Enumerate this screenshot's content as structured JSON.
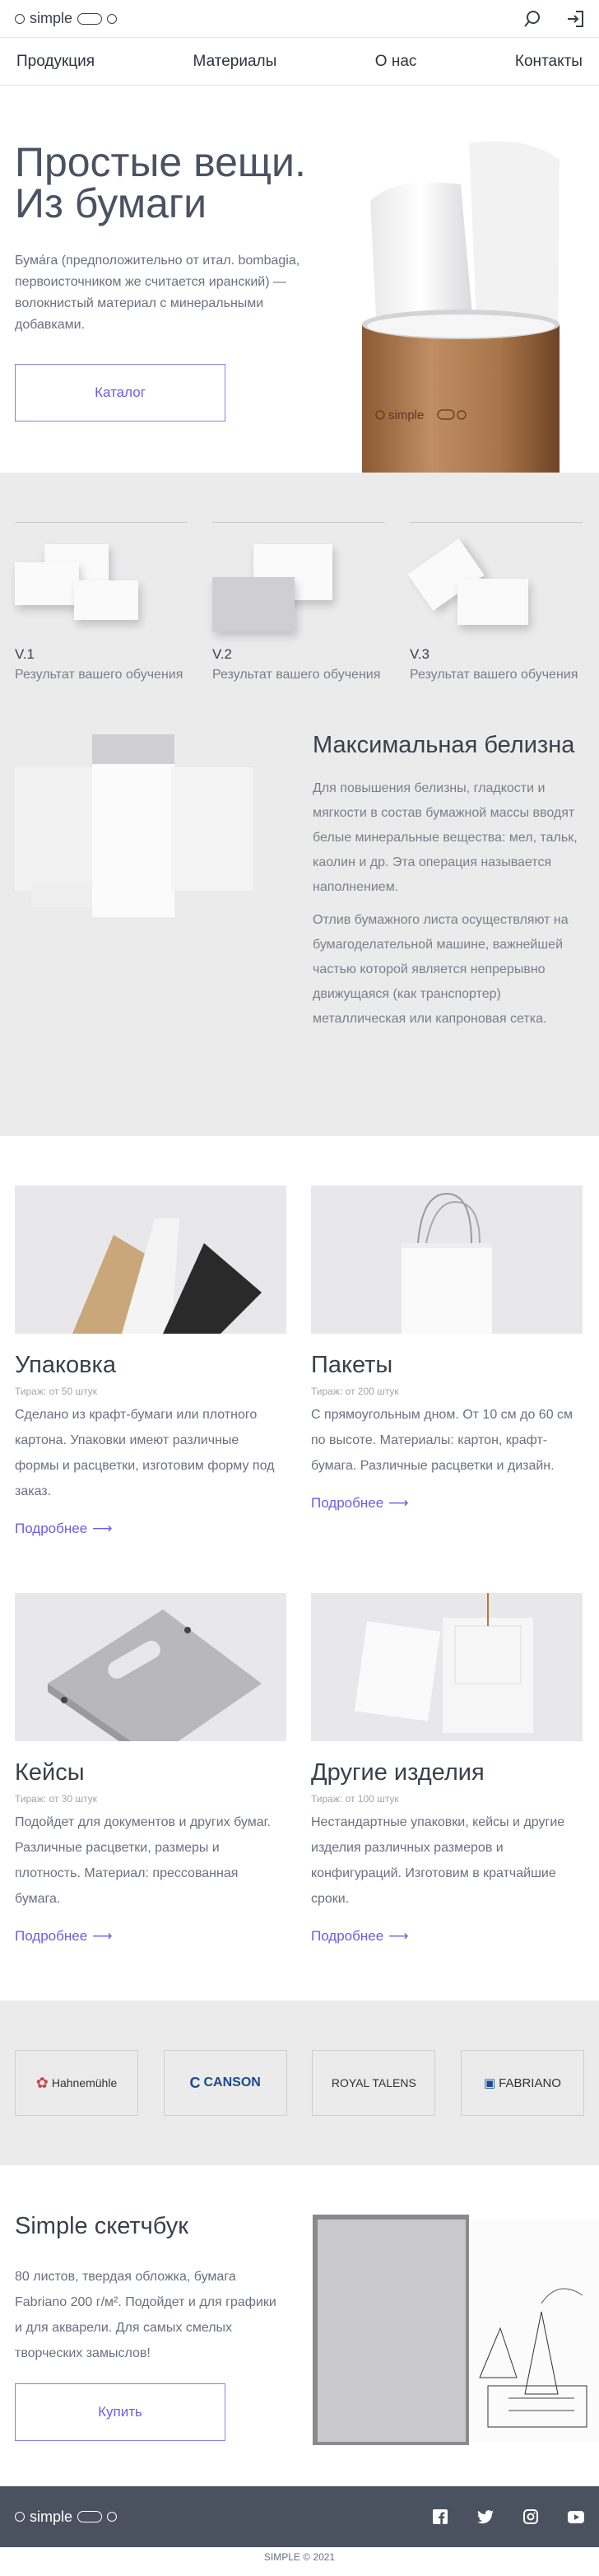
{
  "header": {
    "logo": "simple"
  },
  "nav": [
    "Продукция",
    "Материалы",
    "О нас",
    "Контакты"
  ],
  "hero": {
    "title_line1": "Простые вещи.",
    "title_line2": "Из бумаги",
    "text": "Бума́га (предположительно от итал. bombagia, первоисточником же считается иранский) — волокнистый материал с минеральными добавками.",
    "button": "Каталог",
    "tube_logo": "simple"
  },
  "products": [
    {
      "version": "V.1",
      "desc": "Результат вашего обучения"
    },
    {
      "version": "V.2",
      "desc": "Результат вашего обучения"
    },
    {
      "version": "V.3",
      "desc": "Результат вашего обучения"
    }
  ],
  "whiteness": {
    "title": "Максимальная белизна",
    "p1": "Для повышения белизны, гладкости и мягкости в состав бумажной массы вводят белые минеральные вещества: мел, тальк, каолин и др. Эта операция называется наполнением.",
    "p2": "Отлив бумажного листа осуществляют на бумагоделательной машине, важнейшей частью которой является непрерывно движущаяся (как транспортер) металлическая или капроновая сетка."
  },
  "categories": [
    {
      "title": "Упаковка",
      "run": "Тираж: от 50 штук",
      "text": "Сделано из крафт-бумаги или плотного картона. Упаковки имеют различные формы и расцветки, изготовим форму под заказ.",
      "more": "Подробнее"
    },
    {
      "title": "Пакеты",
      "run": "Тираж: от 200 штук",
      "text": "С прямоугольным дном. От 10 см до 60 см по высоте. Материалы: картон, крафт-бумага. Различные расцветки и дизайн.",
      "more": "Подробнее"
    },
    {
      "title": "Кейсы",
      "run": "Тираж: от 30 штук",
      "text": "Подойдет для документов и других бумаг. Различные расцветки, размеры и плотность. Материал: прессованная бумага.",
      "more": "Подробнее"
    },
    {
      "title": "Другие изделия",
      "run": "Тираж: от 100 штук",
      "text": "Нестандартные упаковки, кейсы и другие изделия различных размеров и конфигураций. Изготовим в кратчайшие сроки.",
      "more": "Подробнее"
    }
  ],
  "brands": [
    "Hahnemühle",
    "CANSON",
    "ROYAL TALENS",
    "FABRIANO"
  ],
  "sketchbook": {
    "title": "Simple скетчбук",
    "text": "80 листов, твердая обложка, бумага Fabriano 200 г/м². Подойдет и для графики и для акварели. Для самых смелых творческих замыслов!",
    "button": "Купить"
  },
  "footer": {
    "logo": "simple",
    "copyright": "SIMPLE © 2021"
  },
  "colors": {
    "accent": "#6a5ee5",
    "footer_bg": "#4a5260",
    "section_gray": "#ebebec"
  }
}
